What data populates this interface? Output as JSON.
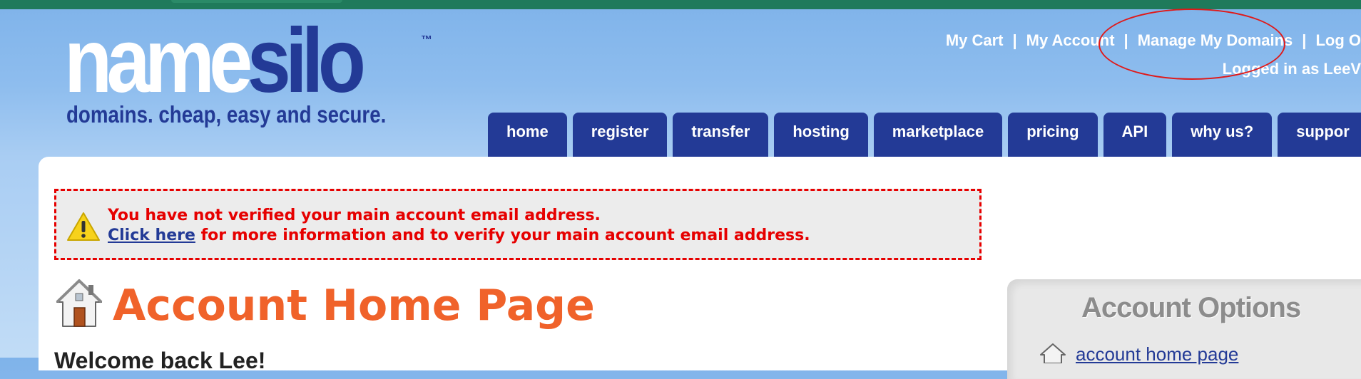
{
  "brand": {
    "name_white": "name",
    "name_blue": "silo",
    "tm": "™",
    "tagline": "domains. cheap, easy and secure."
  },
  "toplinks": {
    "cart": "My Cart",
    "account": "My Account",
    "manage": "Manage My Domains",
    "logout": "Log O",
    "separator": "|",
    "logged_in": "Logged in as LeeV"
  },
  "nav": {
    "tabs": [
      "home",
      "register",
      "transfer",
      "hosting",
      "marketplace",
      "pricing",
      "API",
      "why us?",
      "suppor"
    ]
  },
  "alert": {
    "line1": "You have not verified your main account email address.",
    "link": "Click here",
    "line2_rest": " for more information and to verify your main account email address."
  },
  "main": {
    "title": "Account Home Page",
    "welcome": "Welcome back Lee!"
  },
  "sidebar": {
    "title": "Account Options",
    "item1": "account home page"
  },
  "colors": {
    "brand_blue": "#233a96",
    "title_orange": "#f0622a",
    "alert_red": "#e60000",
    "topbar_green": "#1f7a5b",
    "sky": "#8ebdee"
  }
}
